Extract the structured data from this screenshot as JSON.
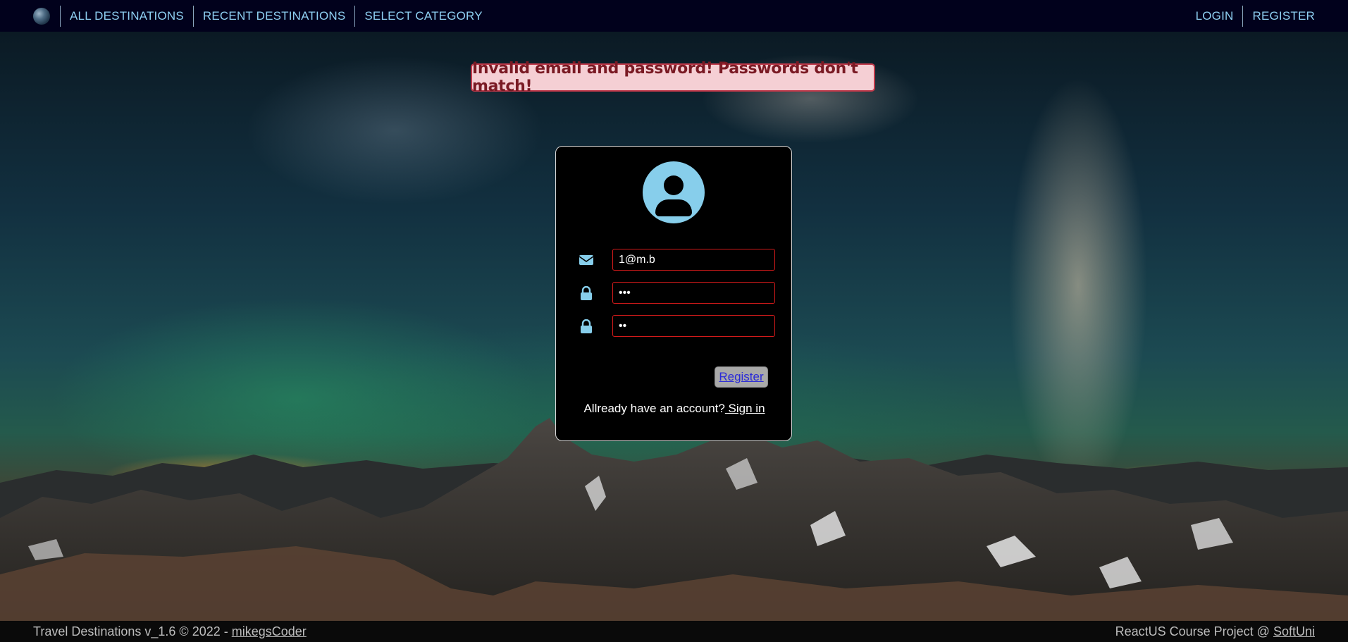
{
  "nav": {
    "logo_icon": "globe-icon",
    "left_links": [
      "ALL DESTINATIONS",
      "RECENT DESTINATIONS",
      "SELECT CATEGORY"
    ],
    "right_links": [
      "LOGIN",
      "REGISTER"
    ],
    "background": "#01011c",
    "link_color": "#8fd0f2"
  },
  "alert": {
    "message": "Invalid email and password! Passwords don't match!",
    "background": "#f5cfd4",
    "border_color": "#c0394a"
  },
  "register_form": {
    "avatar_icon": "user-avatar-icon",
    "fields": [
      {
        "icon": "envelope-icon",
        "type": "email",
        "value": "1@m.b"
      },
      {
        "icon": "lock-icon",
        "type": "password",
        "value": "123"
      },
      {
        "icon": "lock-icon",
        "type": "password",
        "value": "12"
      }
    ],
    "error_border_color": "#d11a1a",
    "submit_label": "Register",
    "signin_prompt": "Allready have an account?",
    "signin_link": " Sign in"
  },
  "footer": {
    "left_text": "Travel Destinations v_1.6 © 2022 - ",
    "left_link": "mikegsCoder",
    "right_text": "ReactUS Course Project @ ",
    "right_link": "SoftUni"
  }
}
